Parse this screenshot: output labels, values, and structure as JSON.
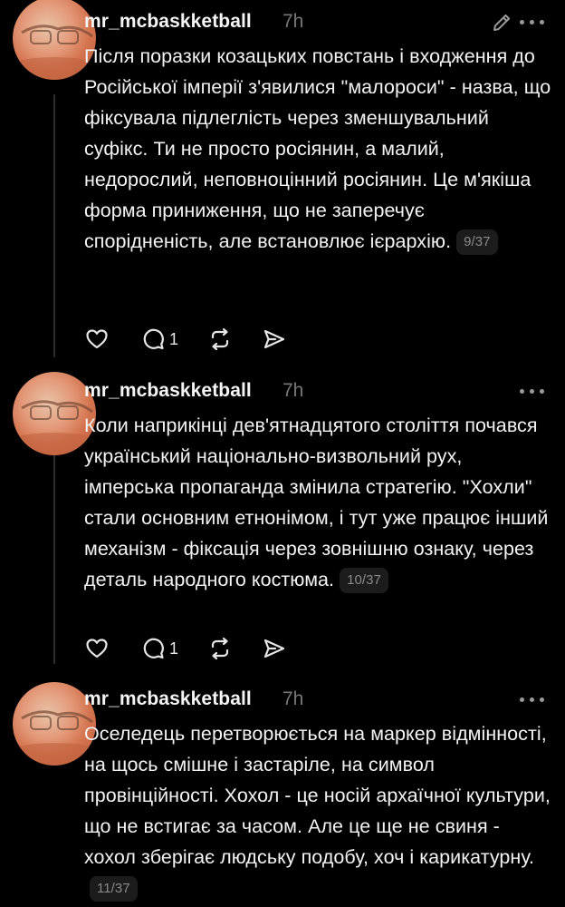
{
  "posts": [
    {
      "username": "mr_mcbaskketball",
      "time": "7h",
      "text": "Після поразки козацьких повстань і входження до Російської імперії з'явилися \"малороси\" - назва, що фіксувала підлеглість через зменшувальний суфікс. Ти не просто росіянин, а малий, недорослий, неповноцінний росіянин. Це м'якіша форма приниження, що не заперечує спорідненість, але встановлює ієрархію.",
      "counter": "9/37",
      "replies": "1",
      "header_icon": "pencil-icon"
    },
    {
      "username": "mr_mcbaskketball",
      "time": "7h",
      "text": "Коли наприкінці дев'ятнадцятого століття почався український національно-визвольний рух, імперська пропаганда змінила стратегію. \"Хохли\" стали основним етнонімом, і тут уже працює інший механізм - фіксація через зовнішню ознаку, через деталь народного костюма.",
      "counter": "10/37",
      "replies": "1",
      "header_icon": "more-icon"
    },
    {
      "username": "mr_mcbaskketball",
      "time": "7h",
      "text": "Оселедець перетворюється на маркер відмінності, на щось смішне і застаріле, на символ провінційності. Хохол - це носій архаїчної культури, що не встигає за часом. Але це ще не свиня - хохол зберігає людську подобу, хоч і карикатурну.",
      "counter": "11/37",
      "header_icon": "more-icon"
    }
  ],
  "colors": {
    "background": "#000000",
    "text": "#f3f3f3",
    "muted": "#777777",
    "thread_line": "#2f2f2f"
  },
  "icons": [
    "heart-icon",
    "comment-icon",
    "repost-icon",
    "share-icon"
  ]
}
